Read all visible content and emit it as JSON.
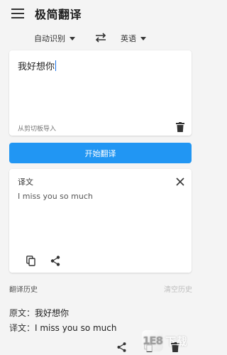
{
  "app": {
    "title": "极简翻译"
  },
  "language": {
    "source": "自动识别",
    "target": "英语"
  },
  "input": {
    "text": "我好想你",
    "paste_label": "从剪切板导入"
  },
  "translate_button": {
    "label": "开始翻译"
  },
  "result": {
    "label": "译文",
    "text": "I miss you so much"
  },
  "history": {
    "title": "翻译历史",
    "clear_label": "清空历史",
    "items": [
      {
        "source_key": "原文：",
        "source": "我好想你",
        "result_key": "译文：",
        "result": "I miss you so much"
      }
    ]
  },
  "watermark": {
    "logo_text": "1E8",
    "text": "下载"
  },
  "colors": {
    "accent": "#2196f3",
    "background": "#f4f4f4",
    "card": "#ffffff"
  },
  "icons": {
    "menu": "menu-icon",
    "swap": "swap-icon",
    "delete": "delete-icon",
    "close": "close-icon",
    "copy": "copy-icon",
    "share": "share-icon"
  }
}
